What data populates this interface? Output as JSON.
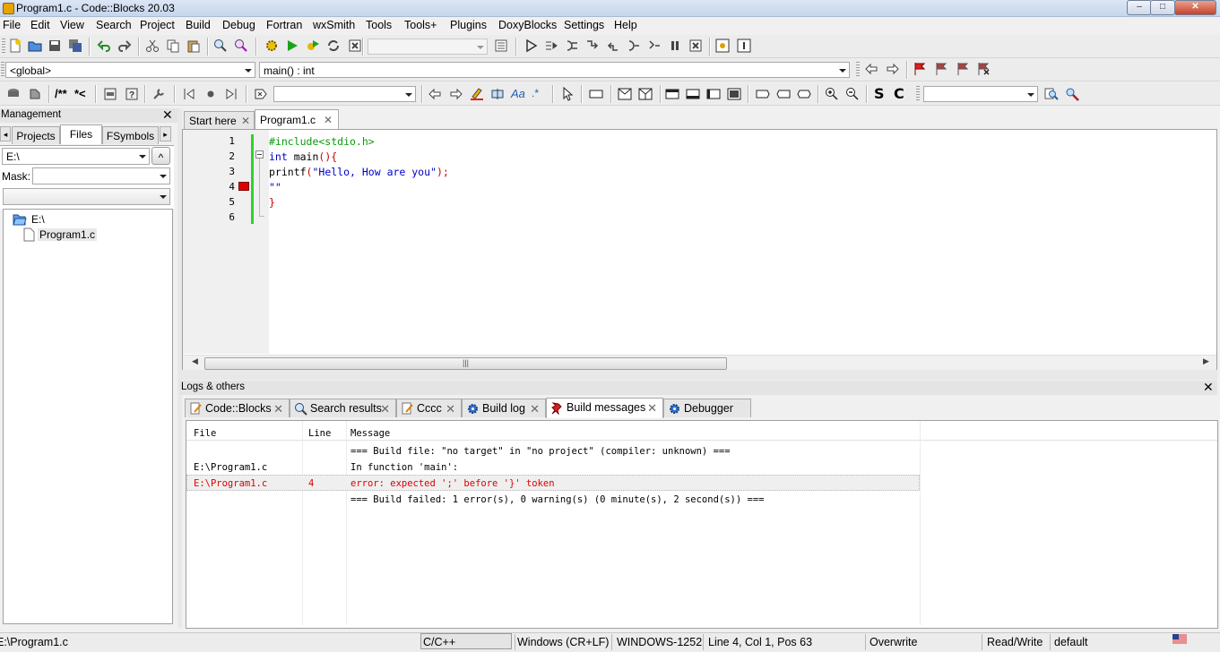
{
  "window": {
    "title": "Program1.c - Code::Blocks 20.03",
    "min": "–",
    "max": "□",
    "close": "✕"
  },
  "menu": [
    "File",
    "Edit",
    "View",
    "Search",
    "Project",
    "Build",
    "Debug",
    "Fortran",
    "wxSmith",
    "Tools",
    "Tools+",
    "Plugins",
    "DoxyBlocks",
    "Settings",
    "Help"
  ],
  "codecompletion": {
    "scope": "<global>",
    "function": "main() : int"
  },
  "toolbar": {
    "doxy_comment": "/**",
    "doxy_line": "*<",
    "regex": ".*",
    "bold_s": "S",
    "bold_c": "C"
  },
  "management": {
    "title": "Management",
    "tabs": [
      "Projects",
      "Files",
      "FSymbols"
    ],
    "path": "E:\\",
    "up": "^",
    "mask_label": "Mask:",
    "tree": {
      "root": "E:\\",
      "file": "Program1.c"
    }
  },
  "editor": {
    "tabs": [
      {
        "label": "Start here"
      },
      {
        "label": "Program1.c"
      }
    ],
    "lines": [
      {
        "n": "1",
        "text": "#include<stdio.h>"
      },
      {
        "n": "2",
        "text": "int main(){"
      },
      {
        "n": "3",
        "text": "printf(\"Hello, How are you\");"
      },
      {
        "n": "4",
        "text": "\"\""
      },
      {
        "n": "5",
        "text": "}"
      },
      {
        "n": "6",
        "text": ""
      }
    ],
    "scroll_grip": "|||"
  },
  "logs": {
    "title": "Logs & others",
    "tabs": [
      "Code::Blocks",
      "Search results",
      "Cccc",
      "Build log",
      "Build messages",
      "Debugger"
    ],
    "columns": [
      "File",
      "Line",
      "Message"
    ],
    "rows": [
      {
        "file": "",
        "line": "",
        "message": "=== Build file: \"no target\" in \"no project\" (compiler: unknown) ==="
      },
      {
        "file": "E:\\Program1.c",
        "line": "",
        "message": "In function 'main':"
      },
      {
        "file": "E:\\Program1.c",
        "line": "4",
        "message": "error: expected ';' before '}' token"
      },
      {
        "file": "",
        "line": "",
        "message": "=== Build failed: 1 error(s), 0 warning(s) (0 minute(s), 2 second(s)) ==="
      }
    ],
    "colors": {
      "error": "#e00000"
    }
  },
  "status": {
    "file": "E:\\Program1.c",
    "language": "C/C++",
    "eol": "Windows (CR+LF)",
    "encoding": "WINDOWS-1252",
    "position": "Line 4, Col 1, Pos 63",
    "mode": "Overwrite",
    "access": "Read/Write",
    "theme": "default"
  }
}
